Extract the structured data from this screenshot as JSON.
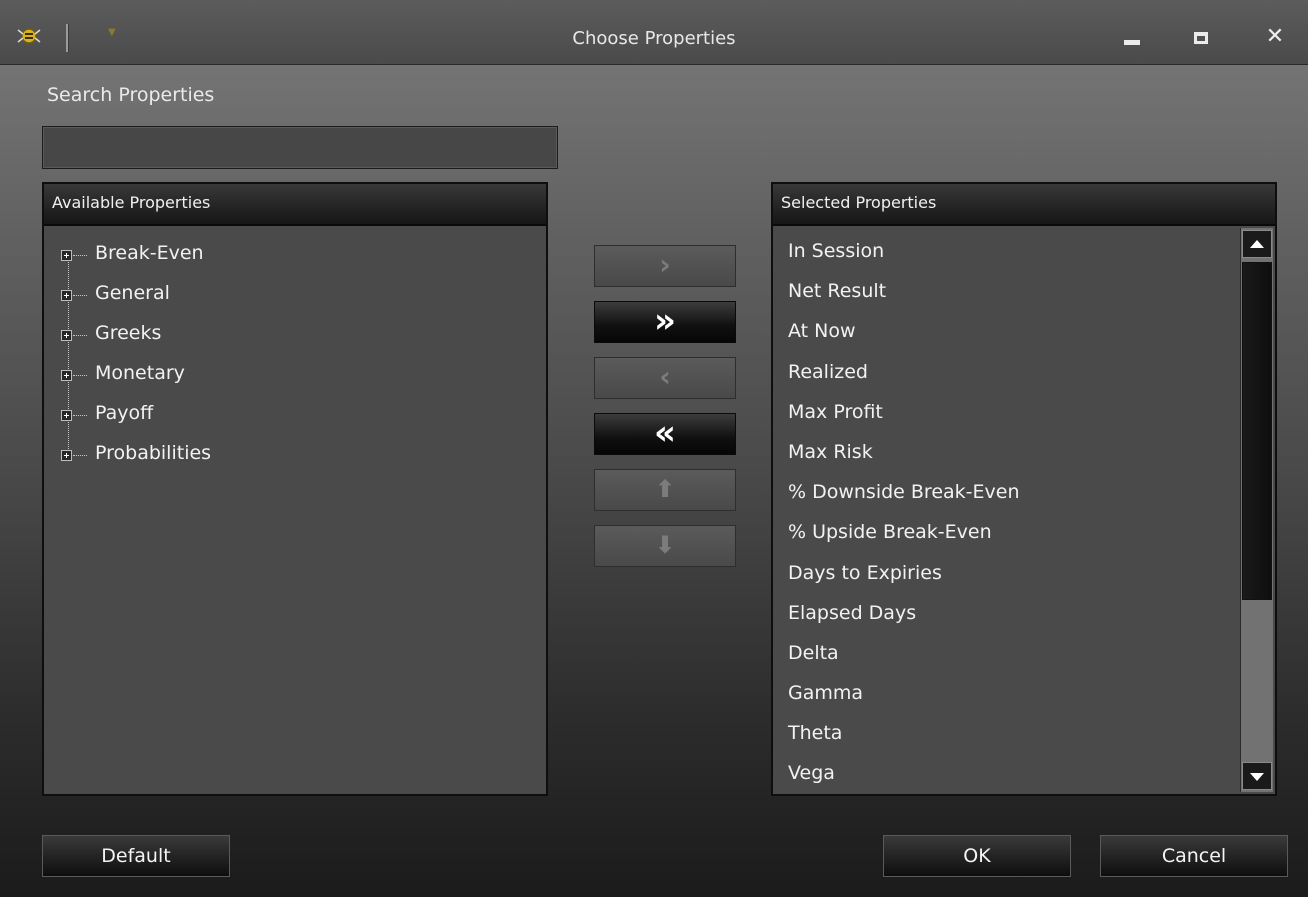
{
  "window": {
    "title": "Choose Properties",
    "close_symbol": "✕"
  },
  "search": {
    "label": "Search Properties",
    "value": ""
  },
  "available": {
    "header": "Available Properties",
    "items": [
      "Break-Even",
      "General",
      "Greeks",
      "Monetary",
      "Payoff",
      "Probabilities"
    ]
  },
  "selected": {
    "header": "Selected Properties",
    "items": [
      "In Session",
      "Net Result",
      "At Now",
      "Realized",
      "Max Profit",
      "Max Risk",
      "% Downside Break-Even",
      "% Upside Break-Even",
      "Days to Expiries",
      "Elapsed Days",
      "Delta",
      "Gamma",
      "Theta",
      "Vega"
    ]
  },
  "move_buttons": {
    "add": "›",
    "add_all": "»",
    "remove": "‹",
    "remove_all": "«",
    "up": "⬆",
    "down": "⬇"
  },
  "footer": {
    "default_label": "Default",
    "ok_label": "OK",
    "cancel_label": "Cancel"
  },
  "icons": {
    "app": "gear-bee-icon",
    "expand": "plus-box-icon",
    "scroll_up": "triangle-up-icon",
    "scroll_down": "triangle-down-icon"
  },
  "colors": {
    "accent_active_button": "#0e0e0e",
    "panel_bg": "#4a4a4a",
    "text": "#f2f2f2"
  }
}
